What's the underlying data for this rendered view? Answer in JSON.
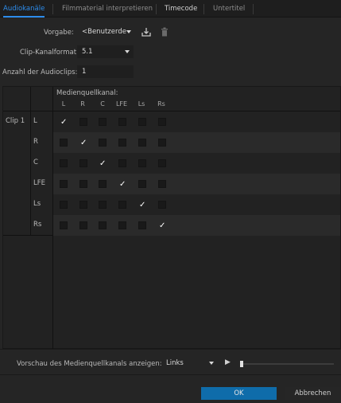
{
  "tabs": [
    {
      "label": "Audiokanäle",
      "active": true
    },
    {
      "label": "Filmmaterial interpretieren",
      "active": false
    },
    {
      "label": "Timecode",
      "active": false
    },
    {
      "label": "Untertitel",
      "active": false
    }
  ],
  "settings": {
    "preset_label": "Vorgabe:",
    "preset_value": "<Benutzerde",
    "clip_format_label": "Clip-Kanalformat",
    "clip_format_value": "5.1",
    "audio_clips_label": "Anzahl der Audioclips:",
    "audio_clips_value": "1"
  },
  "matrix": {
    "header": "Medienquellkanal:",
    "source_channels": [
      "L",
      "R",
      "C",
      "LFE",
      "Ls",
      "Rs"
    ],
    "clip_label": "Clip 1",
    "rows": [
      {
        "label": "L",
        "checked": [
          true,
          false,
          false,
          false,
          false,
          false
        ]
      },
      {
        "label": "R",
        "checked": [
          false,
          true,
          false,
          false,
          false,
          false
        ]
      },
      {
        "label": "C",
        "checked": [
          false,
          false,
          true,
          false,
          false,
          false
        ]
      },
      {
        "label": "LFE",
        "checked": [
          false,
          false,
          false,
          true,
          false,
          false
        ]
      },
      {
        "label": "Ls",
        "checked": [
          false,
          false,
          false,
          false,
          true,
          false
        ]
      },
      {
        "label": "Rs",
        "checked": [
          false,
          false,
          false,
          false,
          false,
          true
        ]
      }
    ]
  },
  "preview": {
    "label": "Vorschau des Medienquellkanals anzeigen:",
    "value": "Links",
    "progress": 0.0
  },
  "buttons": {
    "ok": "OK",
    "cancel": "Abbrechen"
  },
  "colors": {
    "accent": "#2d8ceb",
    "ok_button": "#0f6caa"
  },
  "icons": {
    "check_mark": "✓",
    "play": "▶"
  }
}
